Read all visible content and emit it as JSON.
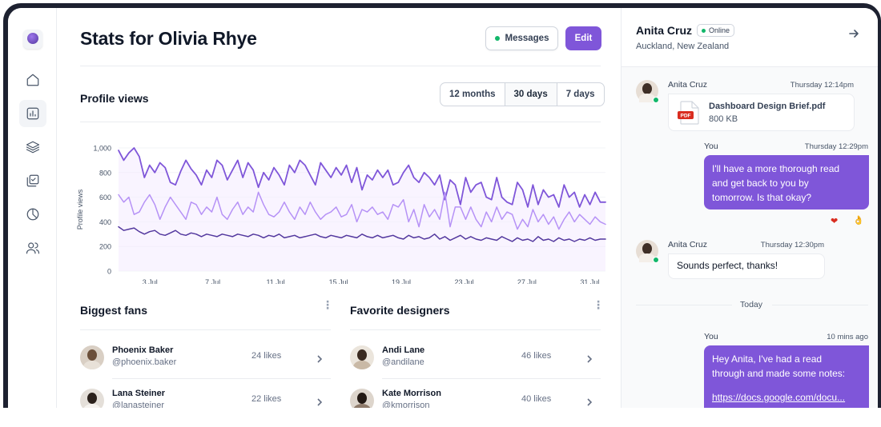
{
  "page": {
    "title": "Stats for Olivia Rhye",
    "messages_label": "Messages",
    "edit_label": "Edit"
  },
  "sidebar": {
    "items": [
      {
        "icon": "home-icon"
      },
      {
        "icon": "bar-chart-icon",
        "active": true
      },
      {
        "icon": "layers-icon"
      },
      {
        "icon": "check-square-icon"
      },
      {
        "icon": "pie-chart-icon"
      },
      {
        "icon": "users-icon"
      }
    ]
  },
  "profile_views": {
    "title": "Profile views",
    "ranges": [
      "12 months",
      "30 days",
      "7 days"
    ],
    "selected_range": "30 days"
  },
  "chart_data": {
    "type": "line",
    "ylabel": "Profile views",
    "ylim": [
      0,
      1000
    ],
    "yticks": [
      "0",
      "200",
      "400",
      "600",
      "800",
      "1,000"
    ],
    "xticks": [
      "3 Jul",
      "7 Jul",
      "11 Jul",
      "15 Jul",
      "19 Jul",
      "23 Jul",
      "27 Jul",
      "31 Jul"
    ],
    "x_range": [
      1,
      32
    ],
    "colors": [
      "#7f56d9",
      "#b692f6",
      "#53389e"
    ],
    "series": [
      {
        "values": [
          980,
          900,
          960,
          1000,
          930,
          760,
          860,
          800,
          880,
          840,
          720,
          700,
          810,
          900,
          830,
          780,
          700,
          820,
          760,
          900,
          860,
          740,
          820,
          900,
          760,
          880,
          820,
          680,
          800,
          740,
          840,
          780,
          700,
          860,
          800,
          900,
          860,
          780,
          700,
          880,
          820,
          760,
          840,
          780,
          860,
          720,
          840,
          660,
          780,
          740,
          820,
          760,
          820,
          700,
          720,
          800,
          860,
          760,
          720,
          800,
          760,
          700,
          780,
          580,
          740,
          700,
          540,
          760,
          640,
          700,
          720,
          600,
          580,
          760,
          600,
          560,
          540,
          720,
          660,
          520,
          700,
          540,
          660,
          600,
          620,
          520,
          700,
          600,
          640,
          520,
          620,
          540,
          640,
          560,
          560
        ]
      },
      {
        "values": [
          620,
          560,
          600,
          460,
          480,
          560,
          620,
          540,
          420,
          520,
          600,
          540,
          480,
          420,
          560,
          540,
          460,
          520,
          480,
          600,
          460,
          420,
          500,
          560,
          460,
          520,
          480,
          640,
          540,
          460,
          440,
          480,
          560,
          480,
          420,
          520,
          460,
          560,
          480,
          420,
          460,
          480,
          520,
          440,
          460,
          540,
          400,
          500,
          480,
          520,
          460,
          480,
          420,
          540,
          520,
          580,
          400,
          500,
          360,
          540,
          440,
          500,
          420,
          640,
          360,
          520,
          520,
          420,
          520,
          420,
          360,
          480,
          400,
          520,
          420,
          480,
          460,
          340,
          420,
          360,
          500,
          400,
          460,
          380,
          440,
          340,
          420,
          480,
          400,
          460,
          420,
          380,
          440,
          400,
          380
        ]
      },
      {
        "values": [
          360,
          330,
          340,
          350,
          320,
          300,
          320,
          330,
          300,
          290,
          310,
          330,
          300,
          290,
          310,
          300,
          280,
          300,
          290,
          280,
          300,
          290,
          280,
          300,
          290,
          280,
          300,
          290,
          270,
          290,
          280,
          300,
          270,
          280,
          290,
          270,
          280,
          290,
          300,
          280,
          270,
          290,
          280,
          270,
          290,
          280,
          270,
          300,
          280,
          270,
          290,
          270,
          280,
          290,
          270,
          260,
          290,
          270,
          280,
          260,
          270,
          300,
          260,
          280,
          250,
          270,
          290,
          260,
          280,
          260,
          250,
          270,
          260,
          250,
          280,
          260,
          240,
          270,
          250,
          260,
          240,
          280,
          250,
          260,
          240,
          270,
          250,
          260,
          240,
          260,
          250,
          270,
          250,
          260,
          260
        ]
      }
    ]
  },
  "biggest_fans": {
    "title": "Biggest fans",
    "rows": [
      {
        "name": "Phoenix Baker",
        "handle": "@phoenix.baker",
        "likes": "24 likes"
      },
      {
        "name": "Lana Steiner",
        "handle": "@lanasteiner",
        "likes": "22 likes"
      }
    ]
  },
  "favorite_designers": {
    "title": "Favorite designers",
    "rows": [
      {
        "name": "Andi Lane",
        "handle": "@andilane",
        "likes": "46 likes"
      },
      {
        "name": "Kate Morrison",
        "handle": "@kmorrison",
        "likes": "40 likes"
      }
    ]
  },
  "chat": {
    "contact_name": "Anita Cruz",
    "status": "Online",
    "location": "Auckland, New Zealand",
    "messages": [
      {
        "sender": "Anita Cruz",
        "time": "Thursday 12:14pm",
        "file_name": "Dashboard Design Brief.pdf",
        "file_size": "800 KB",
        "file_type": "PDF"
      },
      {
        "sender": "You",
        "time": "Thursday 12:29pm",
        "text_lines": [
          "I'll have a more thorough read",
          "and get back to you by",
          "tomorrow. Is that okay?"
        ],
        "reactions": [
          "❤️",
          "👌"
        ]
      },
      {
        "sender": "Anita Cruz",
        "time": "Thursday 12:30pm",
        "text": "Sounds perfect, thanks!"
      },
      {
        "sender": "You",
        "time": "10 mins ago",
        "text_lines": [
          "Hey Anita, I've had a read",
          "through and made some notes:"
        ],
        "link": "https://docs.google.com/docu..."
      }
    ],
    "divider_label": "Today"
  }
}
